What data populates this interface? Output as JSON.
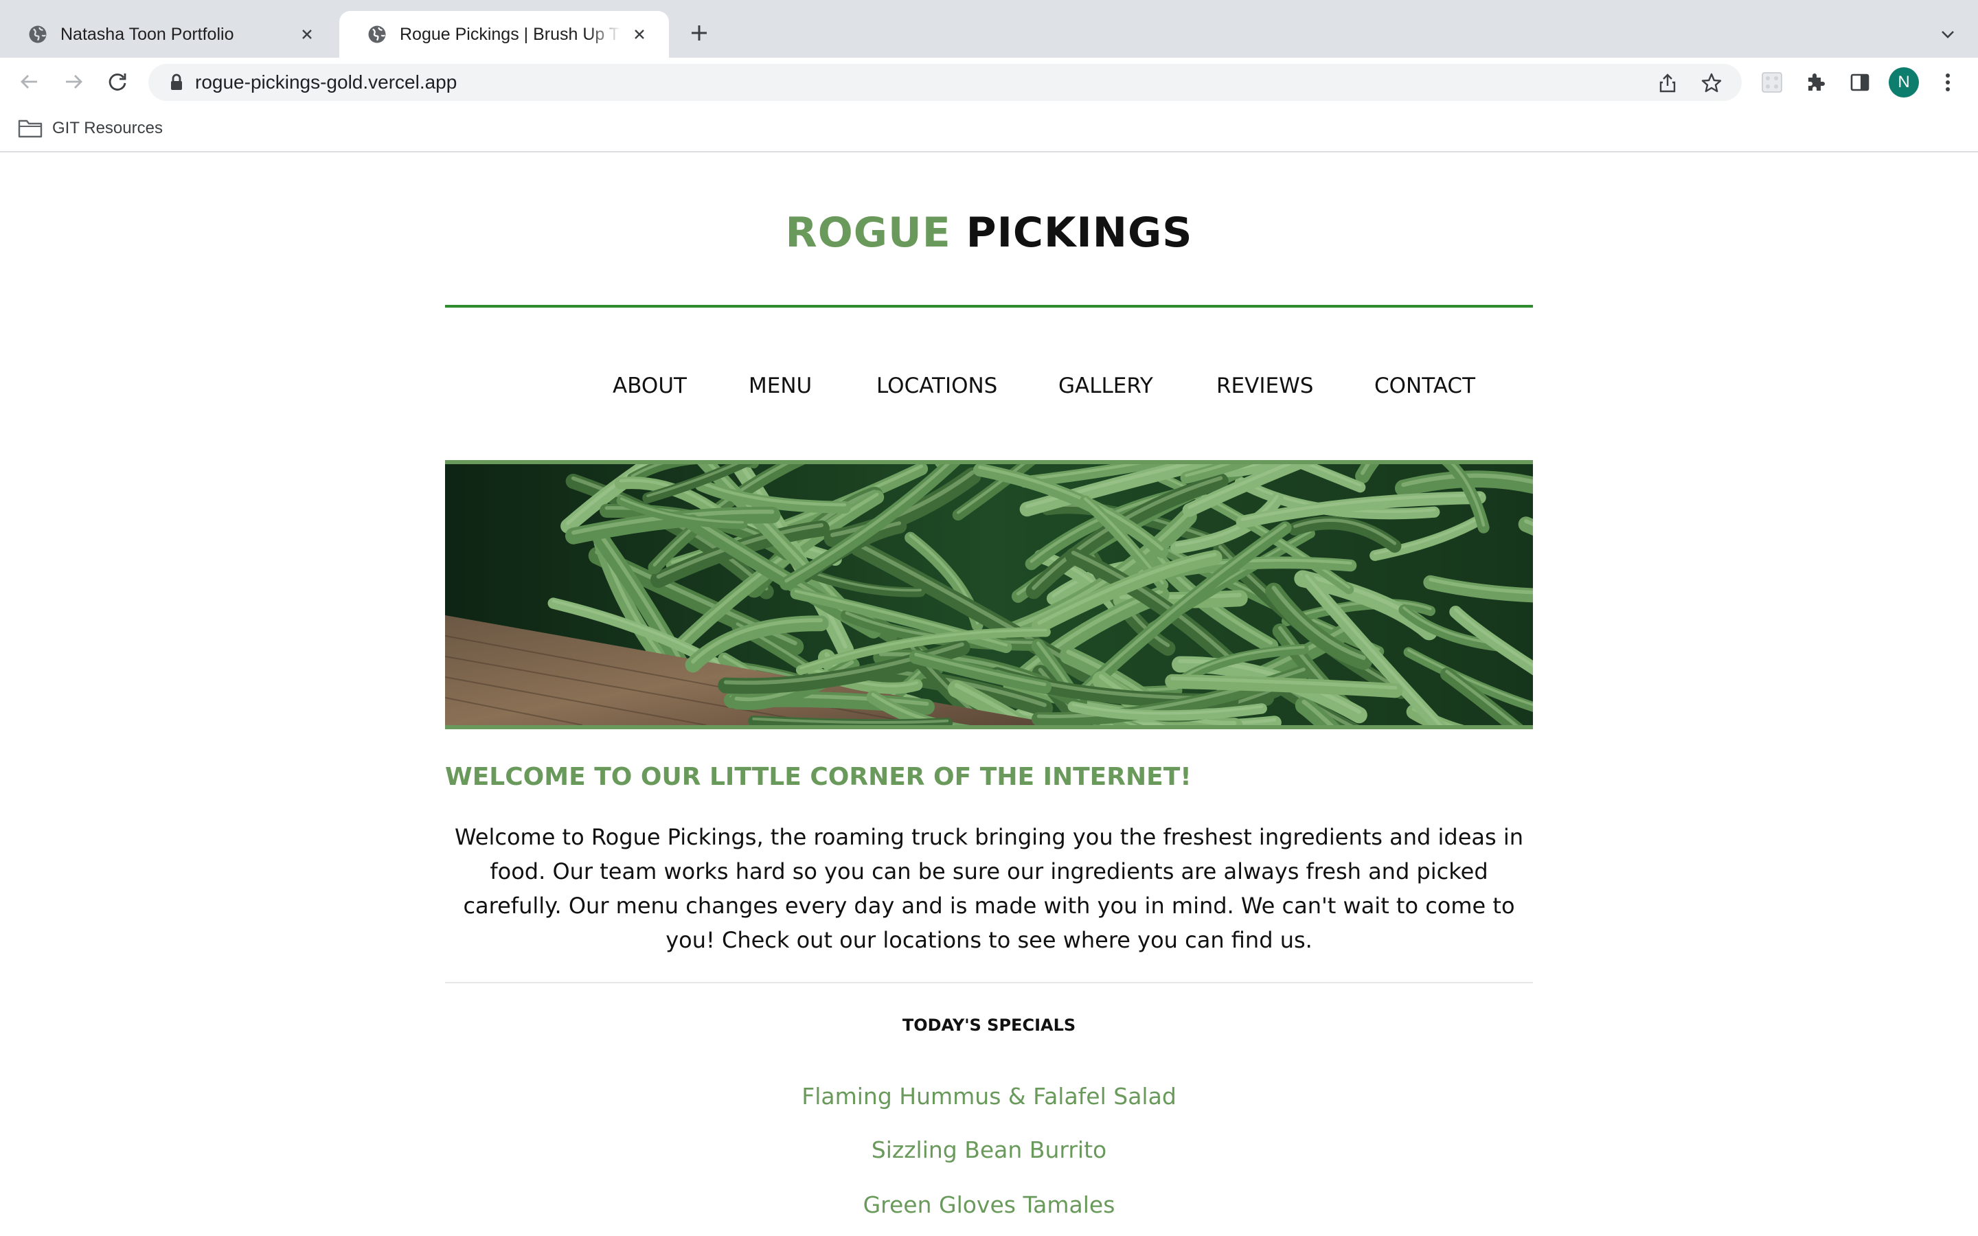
{
  "browser": {
    "tabs": [
      {
        "title": "Natasha Toon Portfolio",
        "active": false,
        "icon": "globe-icon"
      },
      {
        "title": "Rogue Pickings | Brush Up The",
        "active": true,
        "icon": "globe-icon"
      }
    ],
    "url": "rogue-pickings-gold.vercel.app",
    "bookmarks": [
      {
        "label": "GIT Resources",
        "icon": "folder-icon"
      }
    ],
    "profile_initial": "N",
    "colors": {
      "tabstrip": "#dee1e6",
      "avatar": "#0d7d6e"
    }
  },
  "page": {
    "logo": {
      "first": "ROGUE",
      "second": "PICKINGS"
    },
    "nav": [
      "ABOUT",
      "MENU",
      "LOCATIONS",
      "GALLERY",
      "REVIEWS",
      "CONTACT"
    ],
    "hero": {
      "subject": "green beans in wooden crate"
    },
    "welcome": {
      "title": "WELCOME TO OUR LITTLE CORNER OF THE INTERNET!",
      "text": "Welcome to Rogue Pickings, the roaming truck bringing you the freshest ingredients and ideas in food. Our team works hard so you can be sure our ingredients are always fresh and picked carefully. Our menu changes every day and is made with you in mind. We can't wait to come to you! Check out our locations to see where you can find us."
    },
    "specials": {
      "title": "TODAY'S SPECIALS",
      "items": [
        "Flaming Hummus & Falafel Salad",
        "Sizzling Bean Burrito",
        "Green Gloves Tamales"
      ]
    },
    "colors": {
      "accent_green": "#6a9a5b",
      "rule_green": "#2e8b2e"
    }
  }
}
